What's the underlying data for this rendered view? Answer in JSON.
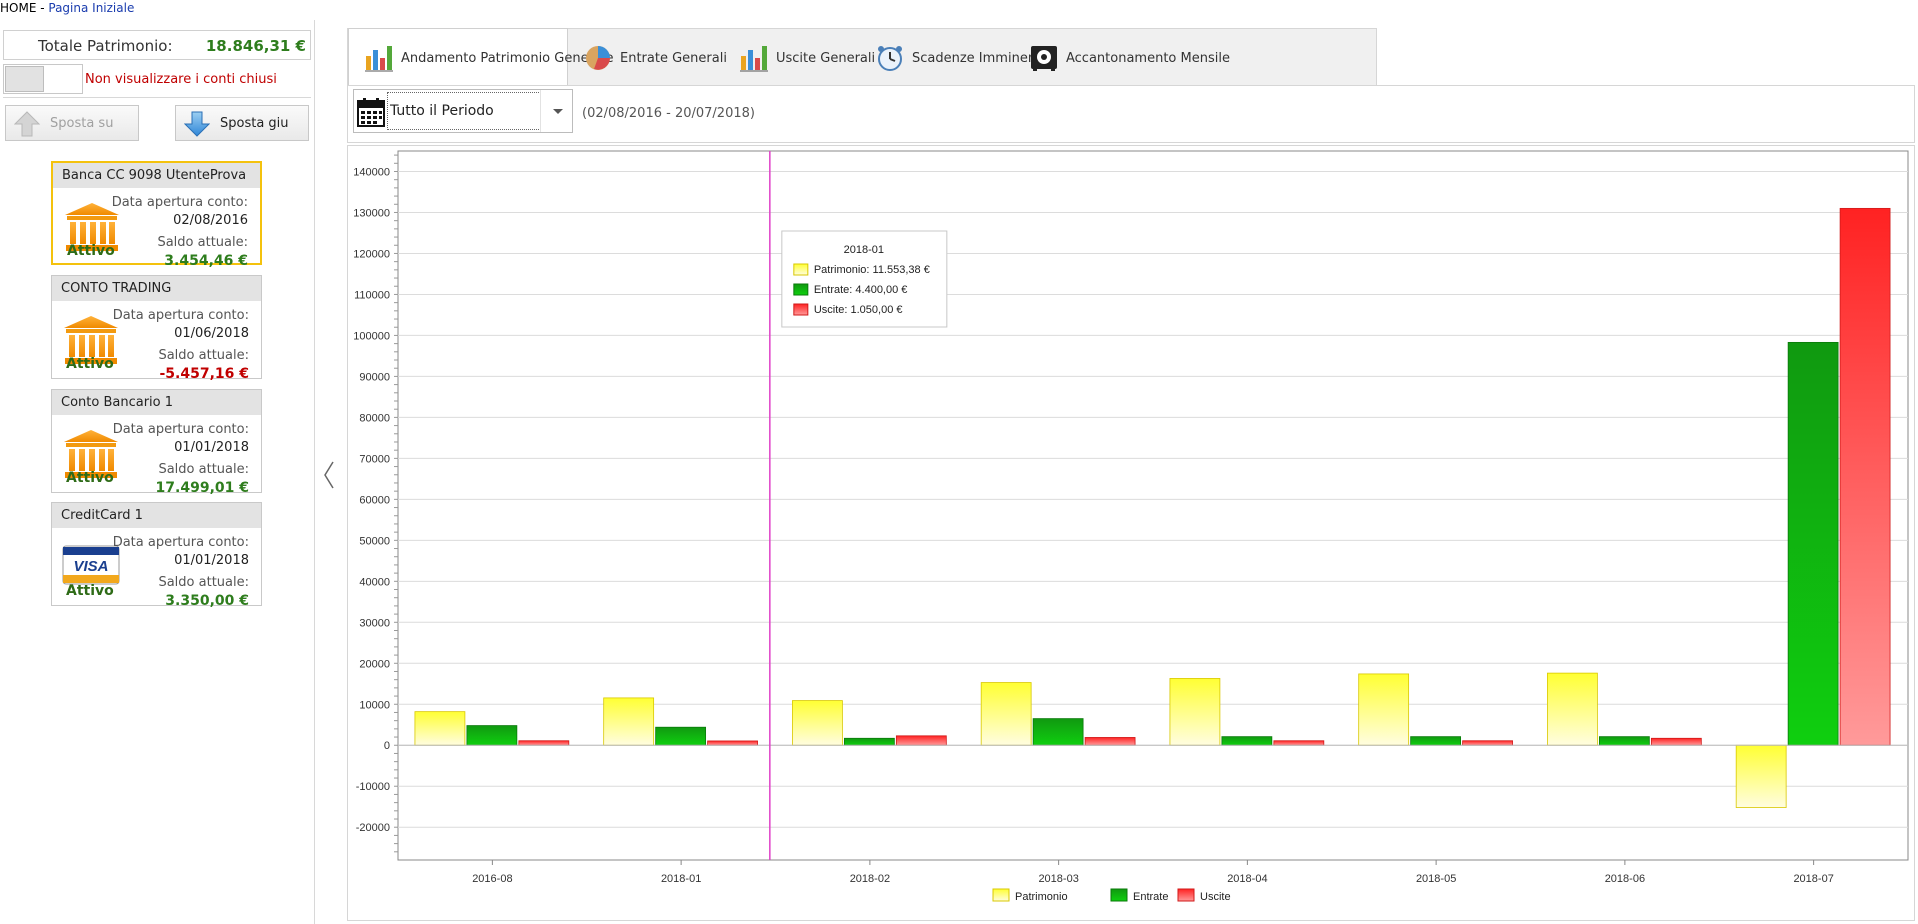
{
  "breadcrumb": {
    "home": "HOME",
    "separator": " - ",
    "page": "Pagina Iniziale"
  },
  "sidebar": {
    "total_label": "Totale Patrimonio:",
    "total_value": "18.846,31 €",
    "hide_closed_label": "Non visualizzare i conti chiusi",
    "move_up_label": "Sposta su",
    "move_down_label": "Sposta giu",
    "accounts": [
      {
        "name": "Banca CC 9098 UtenteProva",
        "status": "Attivo",
        "open_label": "Data apertura conto:",
        "open_date": "02/08/2016",
        "balance_label": "Saldo attuale:",
        "balance": "3.454,46 €",
        "icon": "bank-icon",
        "selected": true
      },
      {
        "name": "CONTO TRADING",
        "status": "Attivo",
        "open_label": "Data apertura conto:",
        "open_date": "01/06/2018",
        "balance_label": "Saldo attuale:",
        "balance": "-5.457,16 €",
        "icon": "bank-icon",
        "selected": false
      },
      {
        "name": "Conto Bancario 1",
        "status": "Attivo",
        "open_label": "Data apertura conto:",
        "open_date": "01/01/2018",
        "balance_label": "Saldo attuale:",
        "balance": "17.499,01 €",
        "icon": "bank-icon",
        "selected": false
      },
      {
        "name": "CreditCard 1",
        "status": "Attivo",
        "open_label": "Data apertura conto:",
        "open_date": "01/01/2018",
        "balance_label": "Saldo attuale:",
        "balance": "3.350,00 €",
        "icon": "visa-card-icon",
        "selected": false
      }
    ]
  },
  "tabs": [
    {
      "label": "Andamento Patrimonio Generale",
      "icon": "bar-chart-icon",
      "active": true
    },
    {
      "label": "Entrate Generali",
      "icon": "pie-chart-icon",
      "active": false
    },
    {
      "label": "Uscite Generali",
      "icon": "bar-chart-icon",
      "active": false
    },
    {
      "label": "Scadenze Imminenti",
      "icon": "alarm-clock-icon",
      "active": false
    },
    {
      "label": "Accantonamento Mensile",
      "icon": "safe-icon",
      "active": false
    }
  ],
  "toolbar": {
    "period_value": "Tutto il Periodo",
    "date_range": "(02/08/2016 - 20/07/2018)"
  },
  "colors": {
    "patrimonio": "#ffff33",
    "entrate": "#109910",
    "uscite": "#ff2222",
    "crosshair": "#e040c8",
    "positive": "#2e7d1d",
    "negative": "#c00000"
  },
  "chart_data": {
    "type": "bar",
    "categories": [
      "2016-08",
      "2018-01",
      "2018-02",
      "2018-03",
      "2018-04",
      "2018-05",
      "2018-06",
      "2018-07"
    ],
    "series": [
      {
        "name": "Patrimonio",
        "values": [
          8200,
          11553.38,
          10900,
          15300,
          16300,
          17400,
          17600,
          -15200
        ]
      },
      {
        "name": "Entrate",
        "values": [
          4800,
          4400,
          1700,
          6500,
          2100,
          2100,
          2100,
          98300
        ]
      },
      {
        "name": "Uscite",
        "values": [
          1100,
          1050,
          2300,
          1900,
          1100,
          1100,
          1700,
          131000
        ]
      }
    ],
    "ylim": [
      -28000,
      145000
    ],
    "yticks": [
      140000,
      130000,
      120000,
      110000,
      100000,
      90000,
      80000,
      70000,
      60000,
      50000,
      40000,
      30000,
      20000,
      10000,
      0,
      -10000,
      -20000
    ],
    "grid": true,
    "legend": "bottom",
    "crosshair_category": "2018-01",
    "tooltip": {
      "title": "2018-01",
      "rows": [
        "Patrimonio: 11.553,38 €",
        "Entrate: 4.400,00 €",
        "Uscite: 1.050,00 €"
      ]
    }
  }
}
